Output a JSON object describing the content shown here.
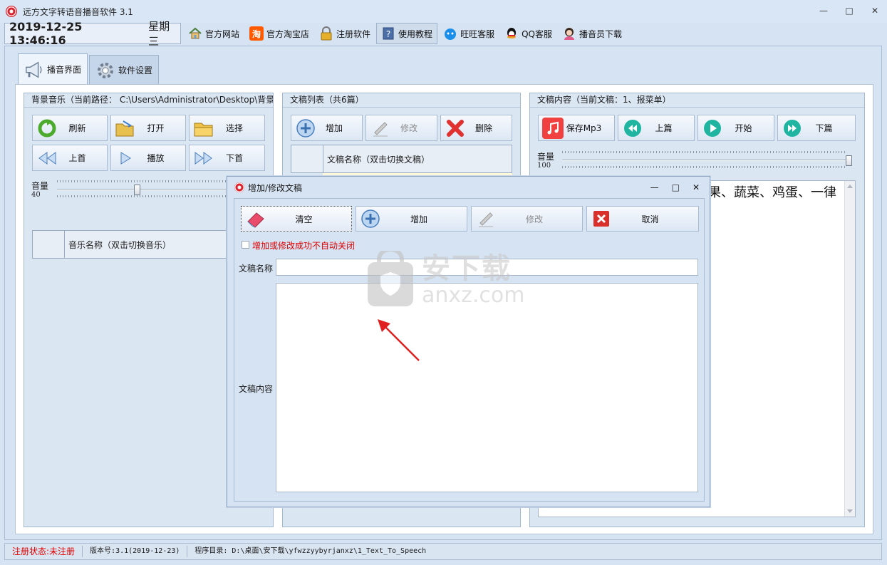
{
  "window": {
    "title": "远方文字转语音播音软件 3.1"
  },
  "toolbar": {
    "date": "2019-12-25 13:46:16",
    "weekday": "星期三",
    "items": [
      {
        "label": "官方网站",
        "icon": "home-icon"
      },
      {
        "label": "官方淘宝店",
        "icon": "taobao-icon"
      },
      {
        "label": "注册软件",
        "icon": "lock-icon"
      },
      {
        "label": "使用教程",
        "icon": "help-book-icon"
      },
      {
        "label": "旺旺客服",
        "icon": "wangwang-icon"
      },
      {
        "label": "QQ客服",
        "icon": "qq-icon"
      },
      {
        "label": "播音员下载",
        "icon": "announcer-icon"
      }
    ]
  },
  "tabs": [
    {
      "label": "播音界面",
      "icon": "megaphone-icon"
    },
    {
      "label": "软件设置",
      "icon": "gear-icon"
    }
  ],
  "music_panel": {
    "title": "背景音乐（当前路径： C:\\Users\\Administrator\\Desktop\\背景",
    "buttons": [
      "刷新",
      "打开",
      "选择",
      "上首",
      "播放",
      "下首"
    ],
    "volume_label": "音量",
    "volume_value": "40",
    "column_header": "音乐名称（双击切换音乐）"
  },
  "doc_list_panel": {
    "title": "文稿列表（共6篇）",
    "buttons": [
      "增加",
      "修改",
      "删除"
    ],
    "column_header": "文稿名称（双击切换文稿）"
  },
  "doc_content_panel": {
    "title": "文稿内容（当前文稿：1、报菜单）",
    "buttons": [
      "保存Mp3",
      "上篇",
      "开始",
      "下篇"
    ],
    "volume_label": "音量",
    "volume_value": "100",
    "text_visible": "果、蔬菜、鸡蛋、一律"
  },
  "dialog": {
    "title": "增加/修改文稿",
    "buttons": [
      "清空",
      "增加",
      "修改",
      "取消"
    ],
    "checkbox_label": "增加或修改成功不自动关闭",
    "name_label": "文稿名称",
    "name_value": "",
    "content_label": "文稿内容",
    "content_value": ""
  },
  "watermark": {
    "cn": "安下载",
    "en": "anxz.com"
  },
  "statusbar": {
    "reg_status": "注册状态:未注册",
    "version": "版本号:3.1(2019-12-23)",
    "program_dir": "程序目录: D:\\桌面\\安下载\\yfwzzyybyrjanxz\\1_Text_To_Speech"
  },
  "colors": {
    "accent_red": "#e00000",
    "panel_bg": "#dbe6f3",
    "border": "#a3b7cf"
  }
}
